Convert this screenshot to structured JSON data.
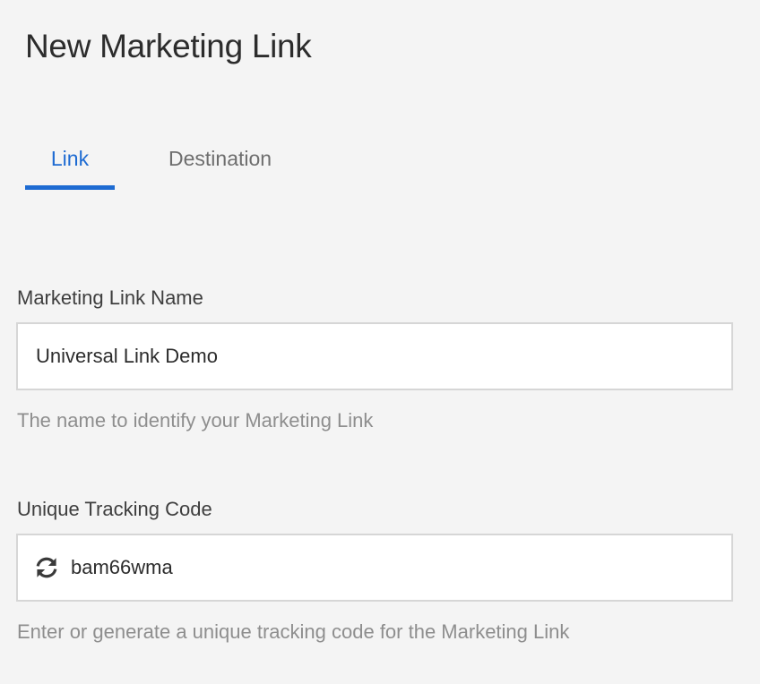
{
  "page": {
    "title": "New Marketing Link"
  },
  "tabs": [
    {
      "label": "Link",
      "active": true
    },
    {
      "label": "Destination",
      "active": false
    }
  ],
  "form": {
    "name": {
      "label": "Marketing Link Name",
      "value": "Universal Link Demo",
      "helper": "The name to identify your Marketing Link"
    },
    "code": {
      "label": "Unique Tracking Code",
      "value": "bam66wma",
      "icon": "refresh-icon",
      "helper": "Enter or generate a unique tracking code for the Marketing Link"
    }
  },
  "colors": {
    "accent": "#1e6bd2",
    "background": "#f4f4f4",
    "field_border": "#d6d6d6",
    "helper_text": "#8e8e8e"
  }
}
